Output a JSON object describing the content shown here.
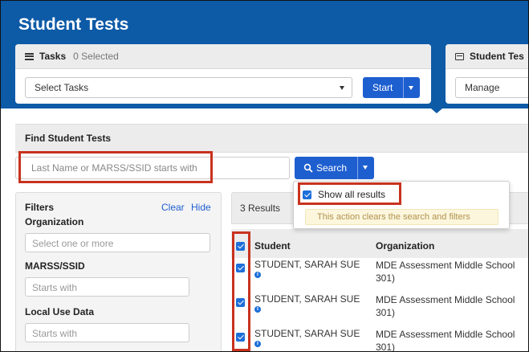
{
  "page": {
    "title": "Student Tests"
  },
  "tasks_panel": {
    "heading": "Tasks",
    "selected_text": "0 Selected",
    "select_value": "Select Tasks",
    "start_label": "Start"
  },
  "student_tests_panel": {
    "heading": "Student Tes",
    "manage_value": "Manage"
  },
  "find": {
    "title": "Find Student Tests",
    "search_placeholder": "Last Name or MARSS/SSID starts with",
    "search_button": "Search",
    "show_all_label": "Show all results",
    "show_all_checked": true,
    "notice": "This action clears the search and filters"
  },
  "filters": {
    "title": "Filters",
    "clear_label": "Clear",
    "hide_label": "Hide",
    "organization_label": "Organization",
    "organization_placeholder": "Select one or more",
    "marss_label": "MARSS/SSID",
    "marss_placeholder": "Starts with",
    "local_label": "Local Use Data",
    "local_placeholder": "Starts with"
  },
  "results": {
    "count_text": "3 Results",
    "columns": {
      "student": "Student",
      "organization": "Organization"
    },
    "rows": [
      {
        "name": "STUDENT, SARAH SUE",
        "org_line1": "MDE Assessment Middle School",
        "org_line2": "301)",
        "checked": true
      },
      {
        "name": "STUDENT, SARAH SUE",
        "org_line1": "MDE Assessment Middle School",
        "org_line2": "301)",
        "checked": true
      },
      {
        "name": "STUDENT, SARAH SUE",
        "org_line1": "MDE Assessment Middle School",
        "org_line2": "301)",
        "checked": true
      }
    ]
  },
  "colors": {
    "header_blue": "#0d5aa7",
    "button_blue": "#1e5fd0",
    "highlight_red": "#c8321e",
    "notice_bg": "#fcf6dc"
  }
}
